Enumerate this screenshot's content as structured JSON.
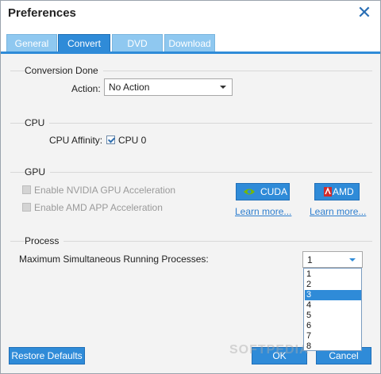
{
  "window": {
    "title": "Preferences"
  },
  "tabs": [
    {
      "label": "General"
    },
    {
      "label": "Convert"
    },
    {
      "label": "DVD"
    },
    {
      "label": "Download"
    }
  ],
  "conversion": {
    "section_label": "Conversion Done",
    "action_label": "Action:",
    "action_value": "No Action"
  },
  "cpu": {
    "section_label": "CPU",
    "affinity_label": "CPU Affinity:",
    "cpu0_label": "CPU 0"
  },
  "gpu": {
    "section_label": "GPU",
    "nvidia_label": "Enable NVIDIA GPU Acceleration",
    "amd_label": "Enable AMD APP Acceleration",
    "cuda_button": "CUDA",
    "amd_button": "AMD",
    "learn_more_cuda": "Learn more...",
    "learn_more_amd": "Learn more..."
  },
  "process": {
    "section_label": "Process",
    "max_label": "Maximum Simultaneous Running Processes:",
    "selected_value": "1",
    "options": [
      "1",
      "2",
      "3",
      "4",
      "5",
      "6",
      "7",
      "8"
    ],
    "highlighted": "3"
  },
  "footer": {
    "restore_label": "Restore Defaults",
    "ok_label": "OK",
    "cancel_label": "Cancel",
    "watermark": "SOFTPEDIA"
  },
  "colors": {
    "accent": "#2f8bd8",
    "tab_inactive": "#8fc8f0",
    "link": "#2f7fcf",
    "cuda_icon": "#76b900",
    "amd_icon": "#d22b2b"
  },
  "icons": {
    "close": "close-icon",
    "cuda": "nvidia-logo-icon",
    "amd": "amd-logo-icon"
  }
}
